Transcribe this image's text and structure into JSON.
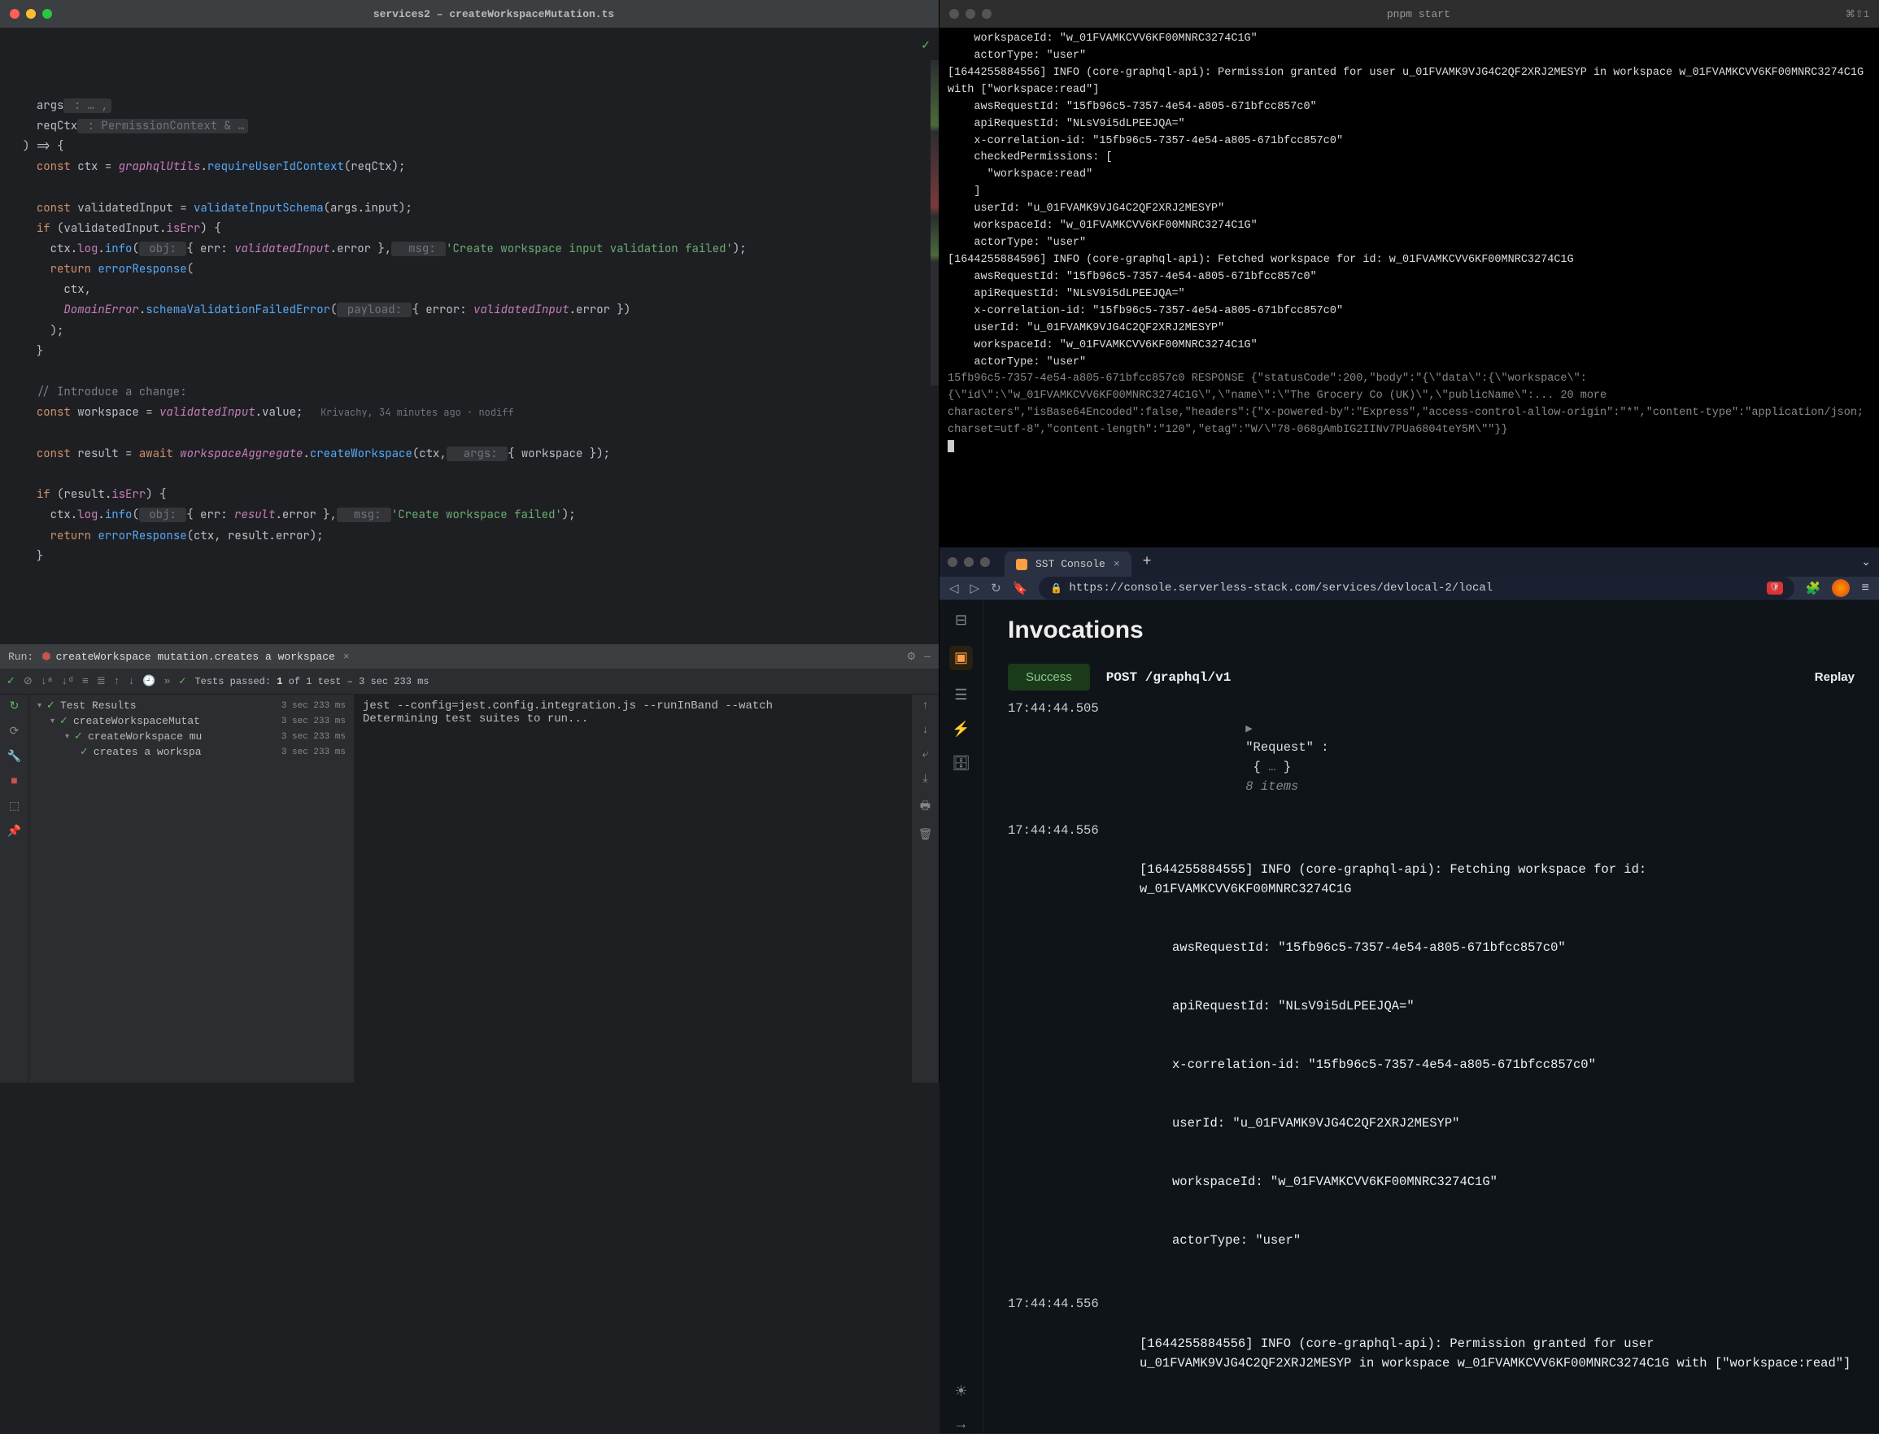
{
  "ide": {
    "title": "services2 – createWorkspaceMutation.ts",
    "code": {
      "l1_args": "args",
      "l1_rest": " : … ,",
      "l2_reqctx": "reqCtx",
      "l2_hint": " : PermissionContext & …",
      "l3": ") => {",
      "l4a": "const ",
      "l4b": "ctx",
      "l4c": " = ",
      "l4d": "graphqlUtils",
      "l4e": ".",
      "l4f": "requireUserIdContext",
      "l4g": "(reqCtx);",
      "l6a": "const ",
      "l6b": "validatedInput",
      "l6c": " = ",
      "l6d": "validateInputSchema",
      "l6e": "(args.input);",
      "l7a": "if ",
      "l7b": "(validatedInput.",
      "l7c": "isErr",
      "l7d": ") {",
      "l8a": "ctx.",
      "l8b": "log",
      "l8c": ".",
      "l8d": "info",
      "l8e": "(",
      "l8hint1": " obj: ",
      "l8f": "{ err: ",
      "l8g": "validatedInput",
      "l8h": ".error },",
      "l8hint2": "  msg: ",
      "l8i": "'Create workspace input validation failed'",
      "l8j": ");",
      "l9a": "return ",
      "l9b": "errorResponse",
      "l9c": "(",
      "l10": "ctx,",
      "l11a": "DomainError",
      "l11b": ".",
      "l11c": "schemaValidationFailedError",
      "l11d": "(",
      "l11hint": " payload: ",
      "l11e": "{ error: ",
      "l11f": "validatedInput",
      "l11g": ".error })",
      "l12": ");",
      "l13": "}",
      "l15": "// Introduce a change:",
      "l16a": "const ",
      "l16b": "workspace",
      "l16c": " = ",
      "l16d": "validatedInput",
      "l16e": ".value;",
      "l16blame": "   Krivachy, 34 minutes ago · nodiff",
      "l18a": "const ",
      "l18b": "result",
      "l18c": " = ",
      "l18d": "await ",
      "l18e": "workspaceAggregate",
      "l18f": ".",
      "l18g": "createWorkspace",
      "l18h": "(ctx,",
      "l18hint": "  args: ",
      "l18i": "{ workspace });",
      "l20a": "if ",
      "l20b": "(result.",
      "l20c": "isErr",
      "l20d": ") {",
      "l21a": "ctx.",
      "l21b": "log",
      "l21c": ".",
      "l21d": "info",
      "l21e": "(",
      "l21hint1": " obj: ",
      "l21f": "{ err: ",
      "l21g": "result",
      "l21h": ".error },",
      "l21hint2": "  msg: ",
      "l21i": "'Create workspace failed'",
      "l21j": ");",
      "l22a": "return ",
      "l22b": "errorResponse",
      "l22c": "(ctx, result.error);",
      "l23": "}"
    },
    "run": {
      "label": "Run:",
      "name": "createWorkspace mutation.creates a workspace",
      "toolbar_status": "Tests passed:",
      "toolbar_count": "1",
      "toolbar_of": " of 1 test – 3 sec 233 ms",
      "tree": {
        "root": "Test Results",
        "root_time": "3 sec 233 ms",
        "n1": "createWorkspaceMutat",
        "n1_time": "3 sec 233 ms",
        "n2": "createWorkspace mu",
        "n2_time": "3 sec 233 ms",
        "n3": "creates a workspa",
        "n3_time": "3 sec 233 ms"
      },
      "console_l1": "jest --config=jest.config.integration.js --runInBand --watch",
      "console_l2": "Determining test suites to run..."
    }
  },
  "term": {
    "title": "pnpm start",
    "opt": "⌘⇧1",
    "lines": [
      "    workspaceId: \"w_01FVAMKCVV6KF00MNRC3274C1G\"",
      "    actorType: \"user\"",
      "[1644255884556] INFO (core-graphql-api): Permission granted for user u_01FVAMK9VJG4C2QF2XRJ2MESYP in workspace w_01FVAMKCVV6KF00MNRC3274C1G with [\"workspace:read\"]",
      "    awsRequestId: \"15fb96c5-7357-4e54-a805-671bfcc857c0\"",
      "    apiRequestId: \"NLsV9i5dLPEEJQA=\"",
      "    x-correlation-id: \"15fb96c5-7357-4e54-a805-671bfcc857c0\"",
      "    checkedPermissions: [",
      "      \"workspace:read\"",
      "    ]",
      "    userId: \"u_01FVAMK9VJG4C2QF2XRJ2MESYP\"",
      "    workspaceId: \"w_01FVAMKCVV6KF00MNRC3274C1G\"",
      "    actorType: \"user\"",
      "[1644255884596] INFO (core-graphql-api): Fetched workspace for id: w_01FVAMKCVV6KF00MNRC3274C1G",
      "    awsRequestId: \"15fb96c5-7357-4e54-a805-671bfcc857c0\"",
      "    apiRequestId: \"NLsV9i5dLPEEJQA=\"",
      "    x-correlation-id: \"15fb96c5-7357-4e54-a805-671bfcc857c0\"",
      "    userId: \"u_01FVAMK9VJG4C2QF2XRJ2MESYP\"",
      "    workspaceId: \"w_01FVAMKCVV6KF00MNRC3274C1G\"",
      "    actorType: \"user\""
    ],
    "response": "15fb96c5-7357-4e54-a805-671bfcc857c0 RESPONSE {\"statusCode\":200,\"body\":\"{\\\"data\\\":{\\\"workspace\\\":{\\\"id\\\":\\\"w_01FVAMKCVV6KF00MNRC3274C1G\\\",\\\"name\\\":\\\"The Grocery Co (UK)\\\",\\\"publicName\\\":... 20 more characters\",\"isBase64Encoded\":false,\"headers\":{\"x-powered-by\":\"Express\",\"access-control-allow-origin\":\"*\",\"content-type\":\"application/json; charset=utf-8\",\"content-length\":\"120\",\"etag\":\"W/\\\"78-068gAmbIG2IINv7PUa6804teY5M\\\"\"}}"
  },
  "browser": {
    "tab_title": "SST Console",
    "url": "https://console.serverless-stack.com/services/devlocal-2/local",
    "page_title": "Invocations",
    "pill": "Success",
    "method": "POST  /graphql/v1",
    "replay": "Replay",
    "rows": [
      {
        "ts": "17:44:44.505",
        "type": "request",
        "req_label": "\"Request\" :",
        "items": "8 items"
      },
      {
        "ts": "17:44:44.556",
        "type": "log",
        "head": "[1644255884555] INFO (core-graphql-api): Fetching workspace for id: w_01FVAMKCVV6KF00MNRC3274C1G",
        "sub": [
          "awsRequestId: \"15fb96c5-7357-4e54-a805-671bfcc857c0\"",
          "apiRequestId: \"NLsV9i5dLPEEJQA=\"",
          "x-correlation-id: \"15fb96c5-7357-4e54-a805-671bfcc857c0\"",
          "userId: \"u_01FVAMK9VJG4C2QF2XRJ2MESYP\"",
          "workspaceId: \"w_01FVAMKCVV6KF00MNRC3274C1G\"",
          "actorType: \"user\""
        ]
      },
      {
        "ts": "17:44:44.556",
        "type": "log",
        "head": "[1644255884556] INFO (core-graphql-api): Permission granted for user u_01FVAMK9VJG4C2QF2XRJ2MESYP in workspace w_01FVAMKCVV6KF00MNRC3274C1G with [\"workspace:read\"]"
      }
    ]
  }
}
